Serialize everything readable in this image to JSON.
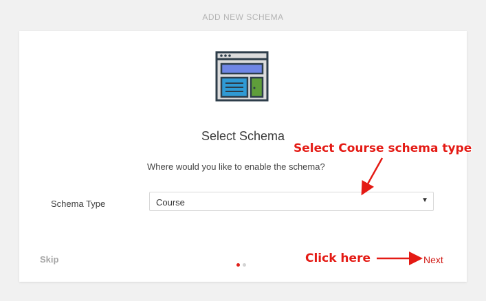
{
  "header": {
    "title": "ADD NEW SCHEMA"
  },
  "card": {
    "icon": "browser-window-icon",
    "title": "Select Schema",
    "subtitle": "Where would you like to enable the schema?",
    "schema_type": {
      "label": "Schema Type",
      "selected": "Course",
      "caret_icon": "▼"
    },
    "footer": {
      "skip_label": "Skip",
      "next_label": "Next",
      "progress": {
        "current": 1,
        "total": 2
      }
    }
  },
  "annotations": {
    "course_hint": "Select Course schema type",
    "click_hint": "Click here"
  },
  "colors": {
    "accent": "#d11b16",
    "annotation": "#e41a14",
    "dot_active": "#e0201a",
    "dot_inactive": "#d3d3d3"
  }
}
